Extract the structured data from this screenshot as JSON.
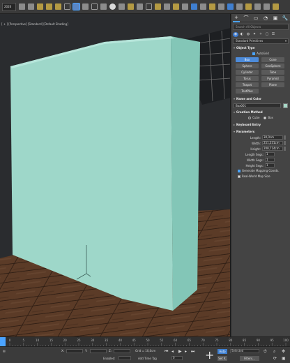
{
  "app": {
    "toolbar_combo": "2026",
    "toolbar_icons": [
      "undo-icon",
      "redo-icon",
      "link-icon",
      "unlink-icon",
      "bind-icon",
      "selection-filter-icon",
      "select-object-icon",
      "select-by-name-icon",
      "rect-selection-icon",
      "window-crossing-icon",
      "move-icon",
      "rotate-icon",
      "scale-icon",
      "reference-coord-icon",
      "pivot-icon",
      "snap-icon",
      "angle-snap-icon",
      "percent-snap-icon",
      "spinner-snap-icon",
      "named-selection-icon",
      "mirror-icon",
      "align-icon",
      "layer-explorer-icon",
      "curve-editor-icon",
      "schematic-icon",
      "material-editor-icon",
      "render-setup-icon",
      "render-frame-icon",
      "render-icon"
    ]
  },
  "viewport": {
    "label": "[ + ] [Perspective] [Standard] [Default Shading]",
    "colors": {
      "box_front": "#9dd6c8",
      "box_side": "#83c7b8",
      "box_top": "#b4e5da",
      "floor": "#5a3b27",
      "background": "#282a2c"
    }
  },
  "command_panel": {
    "tabs": [
      "+",
      "⌒",
      "▭",
      "◔",
      "▣",
      "🔧"
    ],
    "search_placeholder": "Search All Objects",
    "categories": [
      "◉",
      "◐",
      "◍",
      "✦",
      "✧",
      "▢",
      "☰"
    ],
    "dropdown": "Standard Primitives",
    "object_type": {
      "title": "Object Type",
      "autogrid": "AutoGrid",
      "buttons": [
        "Box",
        "Cone",
        "Sphere",
        "GeoSphere",
        "Cylinder",
        "Tube",
        "Torus",
        "Pyramid",
        "Teapot",
        "Plane",
        "TextPlus"
      ]
    },
    "name_color": {
      "title": "Name and Color",
      "name": "Box001",
      "color": "#a6d8c7"
    },
    "creation_method": {
      "title": "Creation Method",
      "cube": "Cube",
      "box": "Box"
    },
    "keyboard_entry": {
      "title": "Keyboard Entry"
    },
    "parameters": {
      "title": "Parameters",
      "rows": [
        {
          "label": "Length:",
          "value": "30,0cm"
        },
        {
          "label": "Width:",
          "value": "251,331cm"
        },
        {
          "label": "Height:",
          "value": "208,714cm"
        },
        {
          "label": "Length Segs:",
          "value": "1"
        },
        {
          "label": "Width Segs:",
          "value": "1"
        },
        {
          "label": "Height Segs:",
          "value": "1"
        }
      ],
      "gen_mapping": "Generate Mapping Coords.",
      "real_world": "Real-World Map Size"
    }
  },
  "timeline": {
    "ticks": [
      "0",
      "5",
      "10",
      "15",
      "20",
      "25",
      "30",
      "35",
      "40",
      "45",
      "50",
      "55",
      "60",
      "65",
      "70",
      "75",
      "80",
      "85",
      "90",
      "95",
      "100"
    ]
  },
  "status": {
    "x": "X:",
    "y": "Y:",
    "z": "Z:",
    "enabled": "Enabled:",
    "grid": "Grid = 10,0cm",
    "add_time_tag": "Add Time Tag",
    "auto": "Auto",
    "set_key": "Set K.",
    "selected": "Selected",
    "filters": "Filters...",
    "frame": "0"
  }
}
